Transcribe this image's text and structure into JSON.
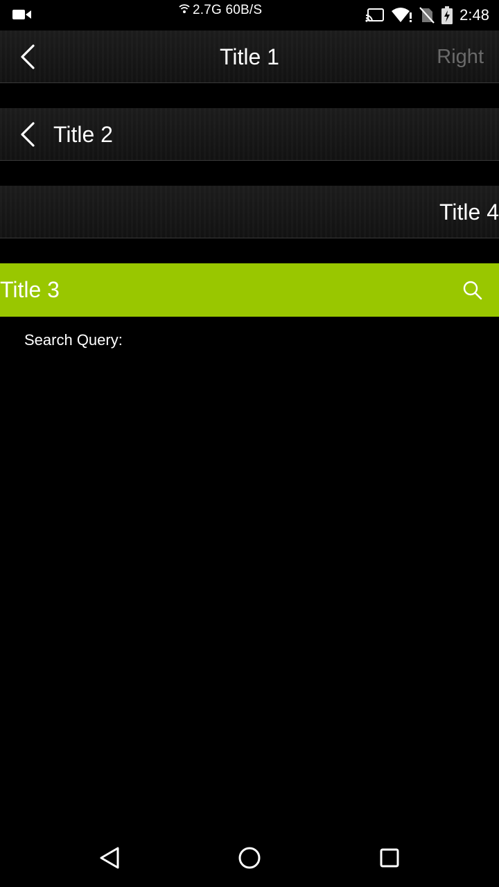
{
  "status_bar": {
    "network_speed": "2.7G 60B/S",
    "time": "2:48",
    "icons": [
      "video-camera-icon",
      "wifi-hotspot-icon",
      "cast-icon",
      "wifi-icon",
      "no-sim-icon",
      "battery-charging-icon"
    ]
  },
  "toolbar1": {
    "title": "Title 1",
    "right_label": "Right",
    "back_icon": "chevron-left-icon"
  },
  "toolbar2": {
    "title": "Title 2",
    "back_icon": "chevron-left-icon"
  },
  "toolbar4": {
    "title": "Title 4"
  },
  "toolbar3": {
    "title": "Title 3",
    "search_icon": "search-icon",
    "background": "#99c700"
  },
  "content": {
    "search_query_label": "Search Query:"
  },
  "nav_bar": {
    "icons": [
      "back-triangle-icon",
      "home-circle-icon",
      "recents-square-icon"
    ]
  }
}
